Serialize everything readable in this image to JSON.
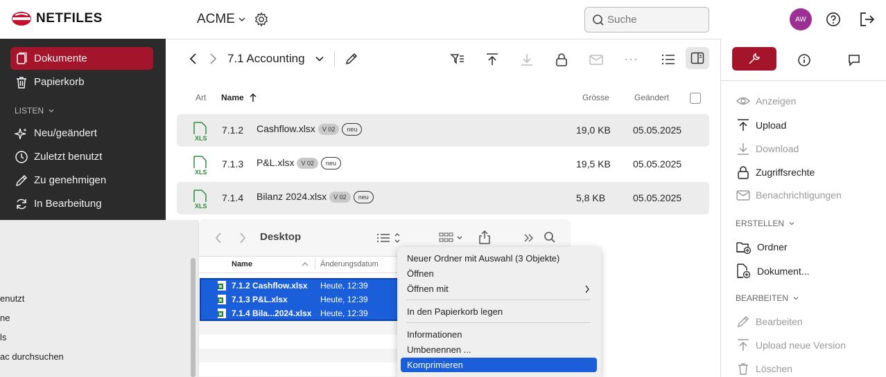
{
  "header": {
    "brand": "NETFILES",
    "workspace": "ACME",
    "search_placeholder": "Suche",
    "avatar_initials": "AW"
  },
  "colors": {
    "accent": "#a4142a",
    "sidebar_bg": "#2b2b2b",
    "selection": "#1a5fd9",
    "avatar": "#9b2f93"
  },
  "sidebar": {
    "items": [
      {
        "label": "Dokumente",
        "icon": "documents-icon"
      },
      {
        "label": "Papierkorb",
        "icon": "trash-icon"
      }
    ],
    "lists_heading": "LISTEN",
    "lists": [
      {
        "label": "Neu/geändert",
        "icon": "sparkle-icon"
      },
      {
        "label": "Zuletzt benutzt",
        "icon": "clock-icon"
      },
      {
        "label": "Zu genehmigen",
        "icon": "pencil-icon"
      },
      {
        "label": "In Bearbeitung",
        "icon": "refresh-icon"
      }
    ]
  },
  "breadcrumb": {
    "folder": "7.1 Accounting"
  },
  "table": {
    "headers": {
      "art": "Art",
      "name": "Name",
      "size": "Grösse",
      "changed": "Geändert"
    },
    "rows": [
      {
        "num": "7.1.2",
        "name": "Cashflow.xlsx",
        "version": "V 02",
        "badge": "neu",
        "size": "19,0 KB",
        "date": "05.05.2025"
      },
      {
        "num": "7.1.3",
        "name": "P&L.xlsx",
        "version": "V 02",
        "badge": "neu",
        "size": "19,5 KB",
        "date": "05.05.2025"
      },
      {
        "num": "7.1.4",
        "name": "Bilanz 2024.xlsx",
        "version": "V 02",
        "badge": "neu",
        "size": "5,8 KB",
        "date": "05.05.2025"
      }
    ]
  },
  "right_panel": {
    "actions": [
      {
        "label": "Anzeigen",
        "enabled": false
      },
      {
        "label": "Upload",
        "enabled": true
      },
      {
        "label": "Download",
        "enabled": false
      },
      {
        "label": "Zugriffsrechte",
        "enabled": true
      },
      {
        "label": "Benachrichtigungen",
        "enabled": false
      }
    ],
    "create_heading": "ERSTELLEN",
    "create": [
      {
        "label": "Ordner"
      },
      {
        "label": "Dokument..."
      }
    ],
    "edit_heading": "BEARBEITEN",
    "edit": [
      {
        "label": "Bearbeiten",
        "enabled": false
      },
      {
        "label": "Upload neue Version",
        "enabled": false
      },
      {
        "label": "Löschen",
        "enabled": false
      }
    ]
  },
  "finder": {
    "sidebar_items": [
      "enutzt",
      "ne",
      "ls",
      "ac durchsuchen"
    ],
    "title": "Desktop",
    "col_name": "Name",
    "col_date": "Änderungsdatum",
    "files": [
      {
        "name": "7.1.2 Cashflow.xlsx",
        "date": "Heute, 12:39"
      },
      {
        "name": "7.1.3 P&L.xlsx",
        "date": "Heute, 12:39"
      },
      {
        "name": "7.1.4 Bila...2024.xlsx",
        "date": "Heute, 12:39"
      }
    ]
  },
  "context_menu": {
    "items": [
      "Neuer Ordner mit Auswahl (3 Objekte)",
      "Öffnen",
      "Öffnen mit",
      "In den Papierkorb legen",
      "Informationen",
      "Umbenennen ...",
      "Komprimieren"
    ],
    "selected": "Komprimieren"
  }
}
